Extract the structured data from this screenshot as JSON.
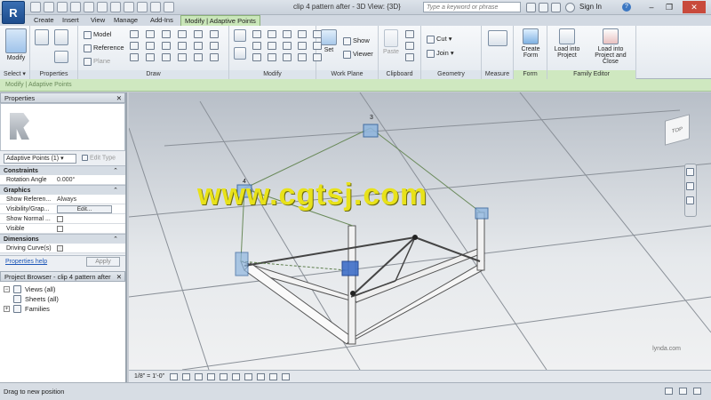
{
  "app": {
    "logo_letter": "R",
    "window_title": "clip 4 pattern after - 3D View: {3D}",
    "search_placeholder": "Type a keyword or phrase",
    "sign_in": "Sign In",
    "help": "?",
    "minimize": "–",
    "restore": "❐",
    "close": "✕"
  },
  "tabs": [
    "Create",
    "Insert",
    "View",
    "Manage",
    "Add-Ins",
    "Modify | Adaptive Points"
  ],
  "ribbon": {
    "select": {
      "modify": "Modify",
      "label": "Select ▾"
    },
    "properties": {
      "label": "Properties"
    },
    "draw": {
      "model": "Model",
      "reference": "Reference",
      "plane": "Plane",
      "label": "Draw"
    },
    "modify": {
      "label": "Modify"
    },
    "workplane": {
      "set": "Set",
      "show": "Show",
      "viewer": "Viewer",
      "label": "Work Plane"
    },
    "clipboard": {
      "paste": "Paste",
      "label": "Clipboard"
    },
    "geometry": {
      "cut": "Cut ▾",
      "join": "Join ▾",
      "label": "Geometry"
    },
    "measure": {
      "label": "Measure"
    },
    "form": {
      "create": "Create",
      "form": "Form",
      "label": "Form"
    },
    "family_editor": {
      "load_project": "Load into",
      "load_project2": "Project",
      "load_close": "Load into",
      "load_close2": "Project and Close",
      "label": "Family Editor"
    }
  },
  "options_bar": "Modify | Adaptive Points",
  "properties": {
    "title": "Properties",
    "close": "✕",
    "type_selector": "Adaptive Points (1)",
    "edit_type": "Edit Type",
    "sections": {
      "constraints": "Constraints",
      "graphics": "Graphics",
      "dimensions": "Dimensions"
    },
    "rows": {
      "rotation_angle_k": "Rotation Angle",
      "rotation_angle_v": "0.000°",
      "show_ref_k": "Show Referen...",
      "show_ref_v": "Always",
      "visibility_k": "Visibility/Grap...",
      "visibility_v": "Edit...",
      "show_normal_k": "Show Normal ...",
      "visible_k": "Visible",
      "driving_curve_k": "Driving Curve(s)"
    },
    "help_link": "Properties help",
    "apply": "Apply"
  },
  "project_browser": {
    "title": "Project Browser - clip 4 pattern after",
    "items": [
      {
        "label": "Views (all)",
        "pm": "−"
      },
      {
        "label": "Sheets (all)",
        "pm": ""
      },
      {
        "label": "Families",
        "pm": "+"
      }
    ]
  },
  "viewport": {
    "watermark": "www.cgtsj.com",
    "watermark_small": "lynda.com",
    "viewcube": "TOP",
    "point_labels": [
      "3",
      "4"
    ]
  },
  "view_control": {
    "scale": "1/8\" = 1'-0\""
  },
  "status": {
    "text": "Drag to new position"
  }
}
